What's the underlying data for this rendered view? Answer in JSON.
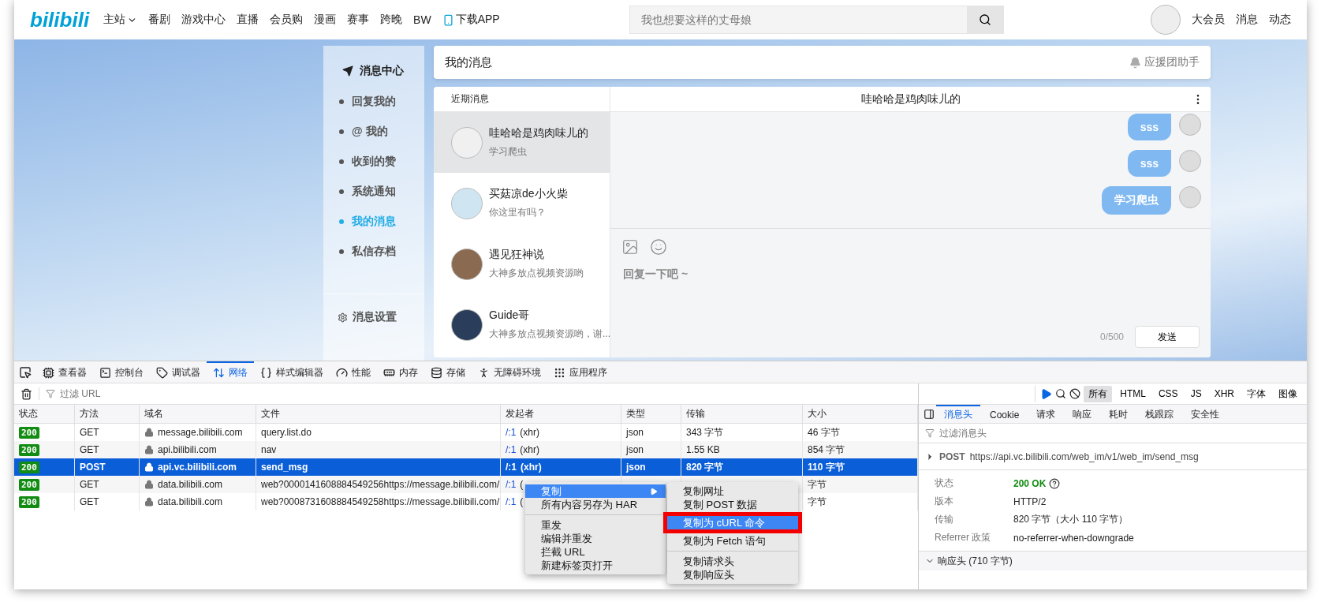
{
  "nav": {
    "logo": "bilibili",
    "items": [
      {
        "label": "主站",
        "kind": "dropdown"
      },
      {
        "label": "番剧",
        "kind": "plain"
      },
      {
        "label": "游戏中心",
        "kind": "plain"
      },
      {
        "label": "直播",
        "kind": "plain"
      },
      {
        "label": "会员购",
        "kind": "plain"
      },
      {
        "label": "漫画",
        "kind": "plain"
      },
      {
        "label": "赛事",
        "kind": "plain"
      },
      {
        "label": "跨晚",
        "kind": "plain"
      },
      {
        "label": "BW",
        "kind": "plain"
      },
      {
        "label": "下载APP",
        "kind": "app"
      }
    ],
    "search": {
      "placeholder": "我也想要这样的丈母娘"
    },
    "right": [
      "大会员",
      "消息",
      "动态"
    ]
  },
  "sidebar": {
    "title": "消息中心",
    "items": [
      {
        "label": "回复我的",
        "selected": false
      },
      {
        "label": "@ 我的",
        "selected": false
      },
      {
        "label": "收到的赞",
        "selected": false
      },
      {
        "label": "系统通知",
        "selected": false
      },
      {
        "label": "我的消息",
        "selected": true
      },
      {
        "label": "私信存档",
        "selected": false
      }
    ],
    "settings": "消息设置"
  },
  "header": {
    "title": "我的消息",
    "helper": "应援团助手"
  },
  "conversations": {
    "title": "近期消息",
    "items": [
      {
        "name": "哇哈哈是鸡肉味儿的",
        "preview": "学习爬虫",
        "selected": true
      },
      {
        "name": "买菇凉de小火柴",
        "preview": "你这里有吗？",
        "selected": false
      },
      {
        "name": "遇见狂神说",
        "preview": "大神多放点视频资源哟",
        "selected": false
      },
      {
        "name": "Guide哥",
        "preview": "大神多放点视频资源哟，谢...",
        "selected": false
      }
    ]
  },
  "chat": {
    "title": "哇哈哈是鸡肉味儿的",
    "messages": [
      "sss",
      "sss",
      "学习爬虫"
    ],
    "placeholder": "回复一下吧 ~",
    "counter": "0/500",
    "send": "发送"
  },
  "devtools": {
    "tabs": [
      {
        "label": "查看器",
        "kind": "inspector",
        "selected": false
      },
      {
        "label": "控制台",
        "kind": "console",
        "selected": false
      },
      {
        "label": "调试器",
        "kind": "debugger",
        "selected": false
      },
      {
        "label": "网络",
        "kind": "network",
        "selected": true
      },
      {
        "label": "样式编辑器",
        "kind": "style",
        "selected": false
      },
      {
        "label": "性能",
        "kind": "performance",
        "selected": false
      },
      {
        "label": "内存",
        "kind": "memory",
        "selected": false
      },
      {
        "label": "存储",
        "kind": "storage",
        "selected": false
      },
      {
        "label": "无障碍环境",
        "kind": "accessibility",
        "selected": false
      },
      {
        "label": "应用程序",
        "kind": "application",
        "selected": false
      }
    ],
    "filter_placeholder": "过滤 URL",
    "type_filters": [
      {
        "label": "所有",
        "selected": true
      },
      {
        "label": "HTML",
        "selected": false
      },
      {
        "label": "CSS",
        "selected": false
      },
      {
        "label": "JS",
        "selected": false
      },
      {
        "label": "XHR",
        "selected": false
      },
      {
        "label": "字体",
        "selected": false
      },
      {
        "label": "图像",
        "selected": false
      }
    ],
    "columns": [
      "状态",
      "方法",
      "域名",
      "文件",
      "发起者",
      "类型",
      "传输",
      "大小"
    ],
    "rows": [
      {
        "status": "200",
        "method": "GET",
        "domain": "message.bilibili.com",
        "file": "query.list.do",
        "initiator_link": "/:1",
        "initiator_note": "(xhr)",
        "type": "json",
        "transfer": "343 字节",
        "size": "46 字节",
        "selected": false
      },
      {
        "status": "200",
        "method": "GET",
        "domain": "api.bilibili.com",
        "file": "nav",
        "initiator_link": "/:1",
        "initiator_note": "(xhr)",
        "type": "json",
        "transfer": "1.55 KB",
        "size": "854 字节",
        "selected": false
      },
      {
        "status": "200",
        "method": "POST",
        "domain": "api.vc.bilibili.com",
        "file": "send_msg",
        "initiator_link": "/:1",
        "initiator_note": "(xhr)",
        "type": "json",
        "transfer": "820 字节",
        "size": "110 字节",
        "selected": true
      },
      {
        "status": "200",
        "method": "GET",
        "domain": "data.bilibili.com",
        "file": "web?0000141608884549256https://message.bilibili.com/",
        "initiator_link": "/:1",
        "initiator_note": "(",
        "size": "字节",
        "selected": false
      },
      {
        "status": "200",
        "method": "GET",
        "domain": "data.bilibili.com",
        "file": "web?0008731608884549258https://message.bilibili.com/",
        "initiator_link": "/:1",
        "initiator_note": "(",
        "size": "字节",
        "selected": false
      }
    ],
    "context_menu": {
      "items": [
        {
          "label": "复制",
          "kind": "submenu",
          "selected": true
        },
        {
          "label": "所有内容另存为 HAR",
          "kind": "item",
          "selected": false
        },
        {
          "kind": "separator"
        },
        {
          "label": "重发",
          "kind": "item",
          "selected": false
        },
        {
          "label": "编辑并重发",
          "kind": "item",
          "selected": false
        },
        {
          "label": "拦截 URL",
          "kind": "item",
          "selected": false
        },
        {
          "label": "新建标签页打开",
          "kind": "item",
          "selected": false
        }
      ],
      "submenu": [
        {
          "label": "复制网址",
          "kind": "item",
          "selected": false
        },
        {
          "label": "复制 POST 数据",
          "kind": "item",
          "selected": false
        },
        {
          "label": "复制为 cURL 命令",
          "kind": "item",
          "selected": true
        },
        {
          "label": "复制为 Fetch 语句",
          "kind": "item",
          "selected": false
        },
        {
          "kind": "separator"
        },
        {
          "label": "复制请求头",
          "kind": "item",
          "selected": false
        },
        {
          "label": "复制响应头",
          "kind": "item",
          "selected": false
        }
      ]
    },
    "details": {
      "tabs": [
        {
          "label": "消息头",
          "selected": true
        },
        {
          "label": "Cookie",
          "selected": false
        },
        {
          "label": "请求",
          "selected": false
        },
        {
          "label": "响应",
          "selected": false
        },
        {
          "label": "耗时",
          "selected": false
        },
        {
          "label": "栈跟踪",
          "selected": false
        },
        {
          "label": "安全性",
          "selected": false
        }
      ],
      "filter_placeholder": "过滤消息头",
      "method": "POST",
      "url": "https://api.vc.bilibili.com/web_im/v1/web_im/send_msg",
      "fields": [
        {
          "label": "状态",
          "value": "200 OK",
          "kind": "status"
        },
        {
          "label": "版本",
          "value": "HTTP/2",
          "kind": "text"
        },
        {
          "label": "传输",
          "value": "820 字节（大小 110 字节）",
          "kind": "text"
        },
        {
          "label": "Referrer 政策",
          "value": "no-referrer-when-downgrade",
          "kind": "text"
        }
      ],
      "section": {
        "label": "响应头 (710 字节)",
        "expanded": true
      }
    }
  }
}
